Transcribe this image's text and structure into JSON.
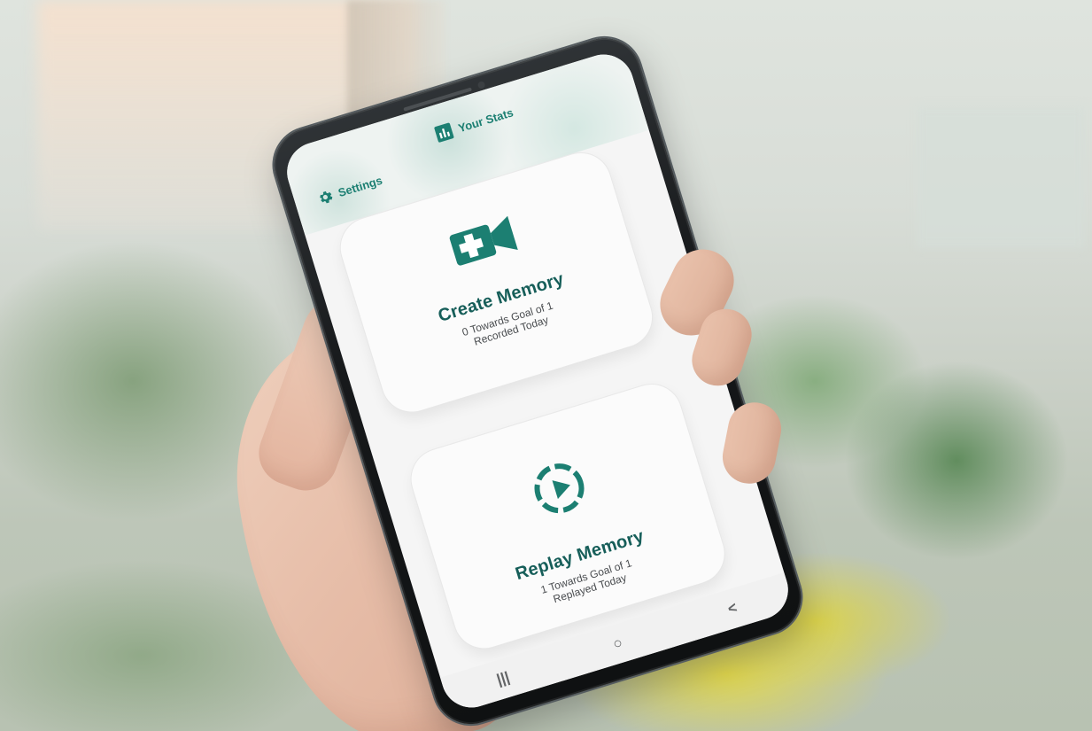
{
  "app": {
    "header": {
      "settings_label": "Settings",
      "stats_label": "Your Stats"
    },
    "cards": {
      "create": {
        "title": "Create Memory",
        "line1": "0 Towards Goal of 1",
        "line2": "Recorded Today",
        "icon": "video-plus-icon"
      },
      "replay": {
        "title": "Replay Memory",
        "line1": "1 Towards Goal of 1",
        "line2": "Replayed Today",
        "icon": "replay-circle-icon"
      }
    },
    "navbar": {
      "recent": "|||",
      "home": "○",
      "back": "<"
    }
  },
  "colors": {
    "accent": "#1c7f72",
    "title": "#165e59"
  }
}
